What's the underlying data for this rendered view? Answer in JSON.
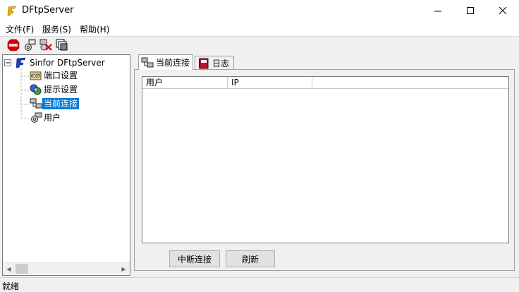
{
  "window": {
    "title": "DFtpServer"
  },
  "menu": {
    "items": [
      "文件(F)",
      "服务(S)",
      "帮助(H)"
    ]
  },
  "toolbar": {
    "icons": [
      "stop-icon",
      "connect-icon",
      "disconnect-icon",
      "windows-icon"
    ]
  },
  "tree": {
    "root": "Sinfor DFtpServer",
    "items": [
      {
        "label": "端口设置",
        "icon": "port-settings-icon"
      },
      {
        "label": "提示设置",
        "icon": "prompt-settings-icon"
      },
      {
        "label": "当前连接",
        "icon": "connections-icon",
        "selected": true
      },
      {
        "label": "用户",
        "icon": "users-icon"
      }
    ]
  },
  "tabs": [
    {
      "label": "当前连接",
      "active": true
    },
    {
      "label": "日志",
      "active": false
    }
  ],
  "list": {
    "columns": [
      "用户",
      "IP"
    ]
  },
  "buttons": {
    "disconnect": "中断连接",
    "refresh": "刷新"
  },
  "status": {
    "text": "就绪"
  },
  "colors": {
    "selection": "#0078d7",
    "stop": "#d40000"
  }
}
